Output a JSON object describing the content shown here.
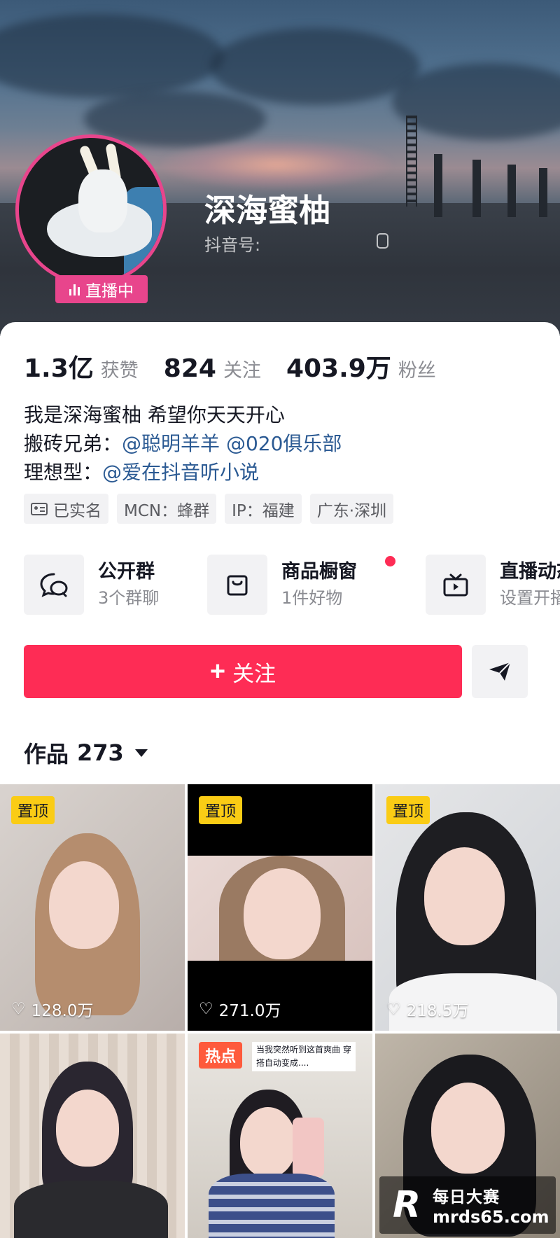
{
  "profile": {
    "nickname": "深海蜜柚",
    "douyin_id_label": "抖音号:",
    "live_badge": "直播中"
  },
  "stats": [
    {
      "value": "1.3亿",
      "label": "获赞"
    },
    {
      "value": "824",
      "label": "关注"
    },
    {
      "value": "403.9万",
      "label": "粉丝"
    }
  ],
  "bio": {
    "line1": "我是深海蜜柚 希望你天天开心",
    "line2_prefix": "搬砖兄弟：",
    "line2_link1": "@聪明羊羊",
    "line2_link2": "@020俱乐部",
    "line3_prefix": "理想型：",
    "line3_link": "@爱在抖音听小说"
  },
  "tags": [
    "已实名",
    "MCN：蜂群",
    "IP：福建",
    "广东·深圳"
  ],
  "services": [
    {
      "title": "公开群",
      "subtitle": "3个群聊",
      "icon": "chat-bubbles-icon"
    },
    {
      "title": "商品橱窗",
      "subtitle": "1件好物",
      "icon": "shopping-bag-icon"
    },
    {
      "title": "直播动态",
      "subtitle": "设置开播提醒",
      "icon": "tv-play-icon"
    }
  ],
  "actions": {
    "follow_label": "关注",
    "share_icon": "paper-plane-icon"
  },
  "works": {
    "label": "作品",
    "count": "273",
    "items": [
      {
        "pinned": "置顶",
        "likes": "128.0万"
      },
      {
        "pinned": "置顶",
        "likes": "271.0万"
      },
      {
        "pinned": "置顶",
        "likes": "218.5万"
      },
      {
        "pinned": "",
        "likes": ""
      },
      {
        "hot": "热点",
        "caption": "当我突然听到这首爽曲 穿搭自动变成....",
        "likes": ""
      },
      {
        "pinned": "",
        "likes": ""
      }
    ]
  },
  "watermark": {
    "logo": "R",
    "title": "每日大赛",
    "url": "mrds65.com"
  },
  "colors": {
    "accent_red": "#fe2c55",
    "live_pink": "#e8458c",
    "link_blue": "#2b5a93",
    "pin_yellow": "#facc15"
  }
}
